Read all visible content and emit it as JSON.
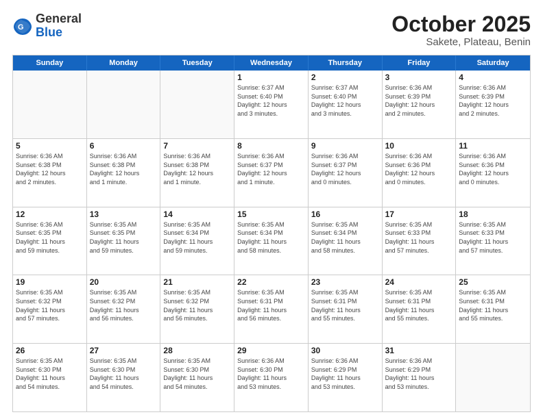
{
  "header": {
    "logo": {
      "general": "General",
      "blue": "Blue"
    },
    "title": "October 2025",
    "location": "Sakete, Plateau, Benin"
  },
  "weekdays": [
    "Sunday",
    "Monday",
    "Tuesday",
    "Wednesday",
    "Thursday",
    "Friday",
    "Saturday"
  ],
  "weeks": [
    [
      {
        "day": "",
        "info": ""
      },
      {
        "day": "",
        "info": ""
      },
      {
        "day": "",
        "info": ""
      },
      {
        "day": "1",
        "info": "Sunrise: 6:37 AM\nSunset: 6:40 PM\nDaylight: 12 hours\nand 3 minutes."
      },
      {
        "day": "2",
        "info": "Sunrise: 6:37 AM\nSunset: 6:40 PM\nDaylight: 12 hours\nand 3 minutes."
      },
      {
        "day": "3",
        "info": "Sunrise: 6:36 AM\nSunset: 6:39 PM\nDaylight: 12 hours\nand 2 minutes."
      },
      {
        "day": "4",
        "info": "Sunrise: 6:36 AM\nSunset: 6:39 PM\nDaylight: 12 hours\nand 2 minutes."
      }
    ],
    [
      {
        "day": "5",
        "info": "Sunrise: 6:36 AM\nSunset: 6:38 PM\nDaylight: 12 hours\nand 2 minutes."
      },
      {
        "day": "6",
        "info": "Sunrise: 6:36 AM\nSunset: 6:38 PM\nDaylight: 12 hours\nand 1 minute."
      },
      {
        "day": "7",
        "info": "Sunrise: 6:36 AM\nSunset: 6:38 PM\nDaylight: 12 hours\nand 1 minute."
      },
      {
        "day": "8",
        "info": "Sunrise: 6:36 AM\nSunset: 6:37 PM\nDaylight: 12 hours\nand 1 minute."
      },
      {
        "day": "9",
        "info": "Sunrise: 6:36 AM\nSunset: 6:37 PM\nDaylight: 12 hours\nand 0 minutes."
      },
      {
        "day": "10",
        "info": "Sunrise: 6:36 AM\nSunset: 6:36 PM\nDaylight: 12 hours\nand 0 minutes."
      },
      {
        "day": "11",
        "info": "Sunrise: 6:36 AM\nSunset: 6:36 PM\nDaylight: 12 hours\nand 0 minutes."
      }
    ],
    [
      {
        "day": "12",
        "info": "Sunrise: 6:36 AM\nSunset: 6:35 PM\nDaylight: 11 hours\nand 59 minutes."
      },
      {
        "day": "13",
        "info": "Sunrise: 6:35 AM\nSunset: 6:35 PM\nDaylight: 11 hours\nand 59 minutes."
      },
      {
        "day": "14",
        "info": "Sunrise: 6:35 AM\nSunset: 6:34 PM\nDaylight: 11 hours\nand 59 minutes."
      },
      {
        "day": "15",
        "info": "Sunrise: 6:35 AM\nSunset: 6:34 PM\nDaylight: 11 hours\nand 58 minutes."
      },
      {
        "day": "16",
        "info": "Sunrise: 6:35 AM\nSunset: 6:34 PM\nDaylight: 11 hours\nand 58 minutes."
      },
      {
        "day": "17",
        "info": "Sunrise: 6:35 AM\nSunset: 6:33 PM\nDaylight: 11 hours\nand 57 minutes."
      },
      {
        "day": "18",
        "info": "Sunrise: 6:35 AM\nSunset: 6:33 PM\nDaylight: 11 hours\nand 57 minutes."
      }
    ],
    [
      {
        "day": "19",
        "info": "Sunrise: 6:35 AM\nSunset: 6:32 PM\nDaylight: 11 hours\nand 57 minutes."
      },
      {
        "day": "20",
        "info": "Sunrise: 6:35 AM\nSunset: 6:32 PM\nDaylight: 11 hours\nand 56 minutes."
      },
      {
        "day": "21",
        "info": "Sunrise: 6:35 AM\nSunset: 6:32 PM\nDaylight: 11 hours\nand 56 minutes."
      },
      {
        "day": "22",
        "info": "Sunrise: 6:35 AM\nSunset: 6:31 PM\nDaylight: 11 hours\nand 56 minutes."
      },
      {
        "day": "23",
        "info": "Sunrise: 6:35 AM\nSunset: 6:31 PM\nDaylight: 11 hours\nand 55 minutes."
      },
      {
        "day": "24",
        "info": "Sunrise: 6:35 AM\nSunset: 6:31 PM\nDaylight: 11 hours\nand 55 minutes."
      },
      {
        "day": "25",
        "info": "Sunrise: 6:35 AM\nSunset: 6:31 PM\nDaylight: 11 hours\nand 55 minutes."
      }
    ],
    [
      {
        "day": "26",
        "info": "Sunrise: 6:35 AM\nSunset: 6:30 PM\nDaylight: 11 hours\nand 54 minutes."
      },
      {
        "day": "27",
        "info": "Sunrise: 6:35 AM\nSunset: 6:30 PM\nDaylight: 11 hours\nand 54 minutes."
      },
      {
        "day": "28",
        "info": "Sunrise: 6:35 AM\nSunset: 6:30 PM\nDaylight: 11 hours\nand 54 minutes."
      },
      {
        "day": "29",
        "info": "Sunrise: 6:36 AM\nSunset: 6:30 PM\nDaylight: 11 hours\nand 53 minutes."
      },
      {
        "day": "30",
        "info": "Sunrise: 6:36 AM\nSunset: 6:29 PM\nDaylight: 11 hours\nand 53 minutes."
      },
      {
        "day": "31",
        "info": "Sunrise: 6:36 AM\nSunset: 6:29 PM\nDaylight: 11 hours\nand 53 minutes."
      },
      {
        "day": "",
        "info": ""
      }
    ]
  ]
}
